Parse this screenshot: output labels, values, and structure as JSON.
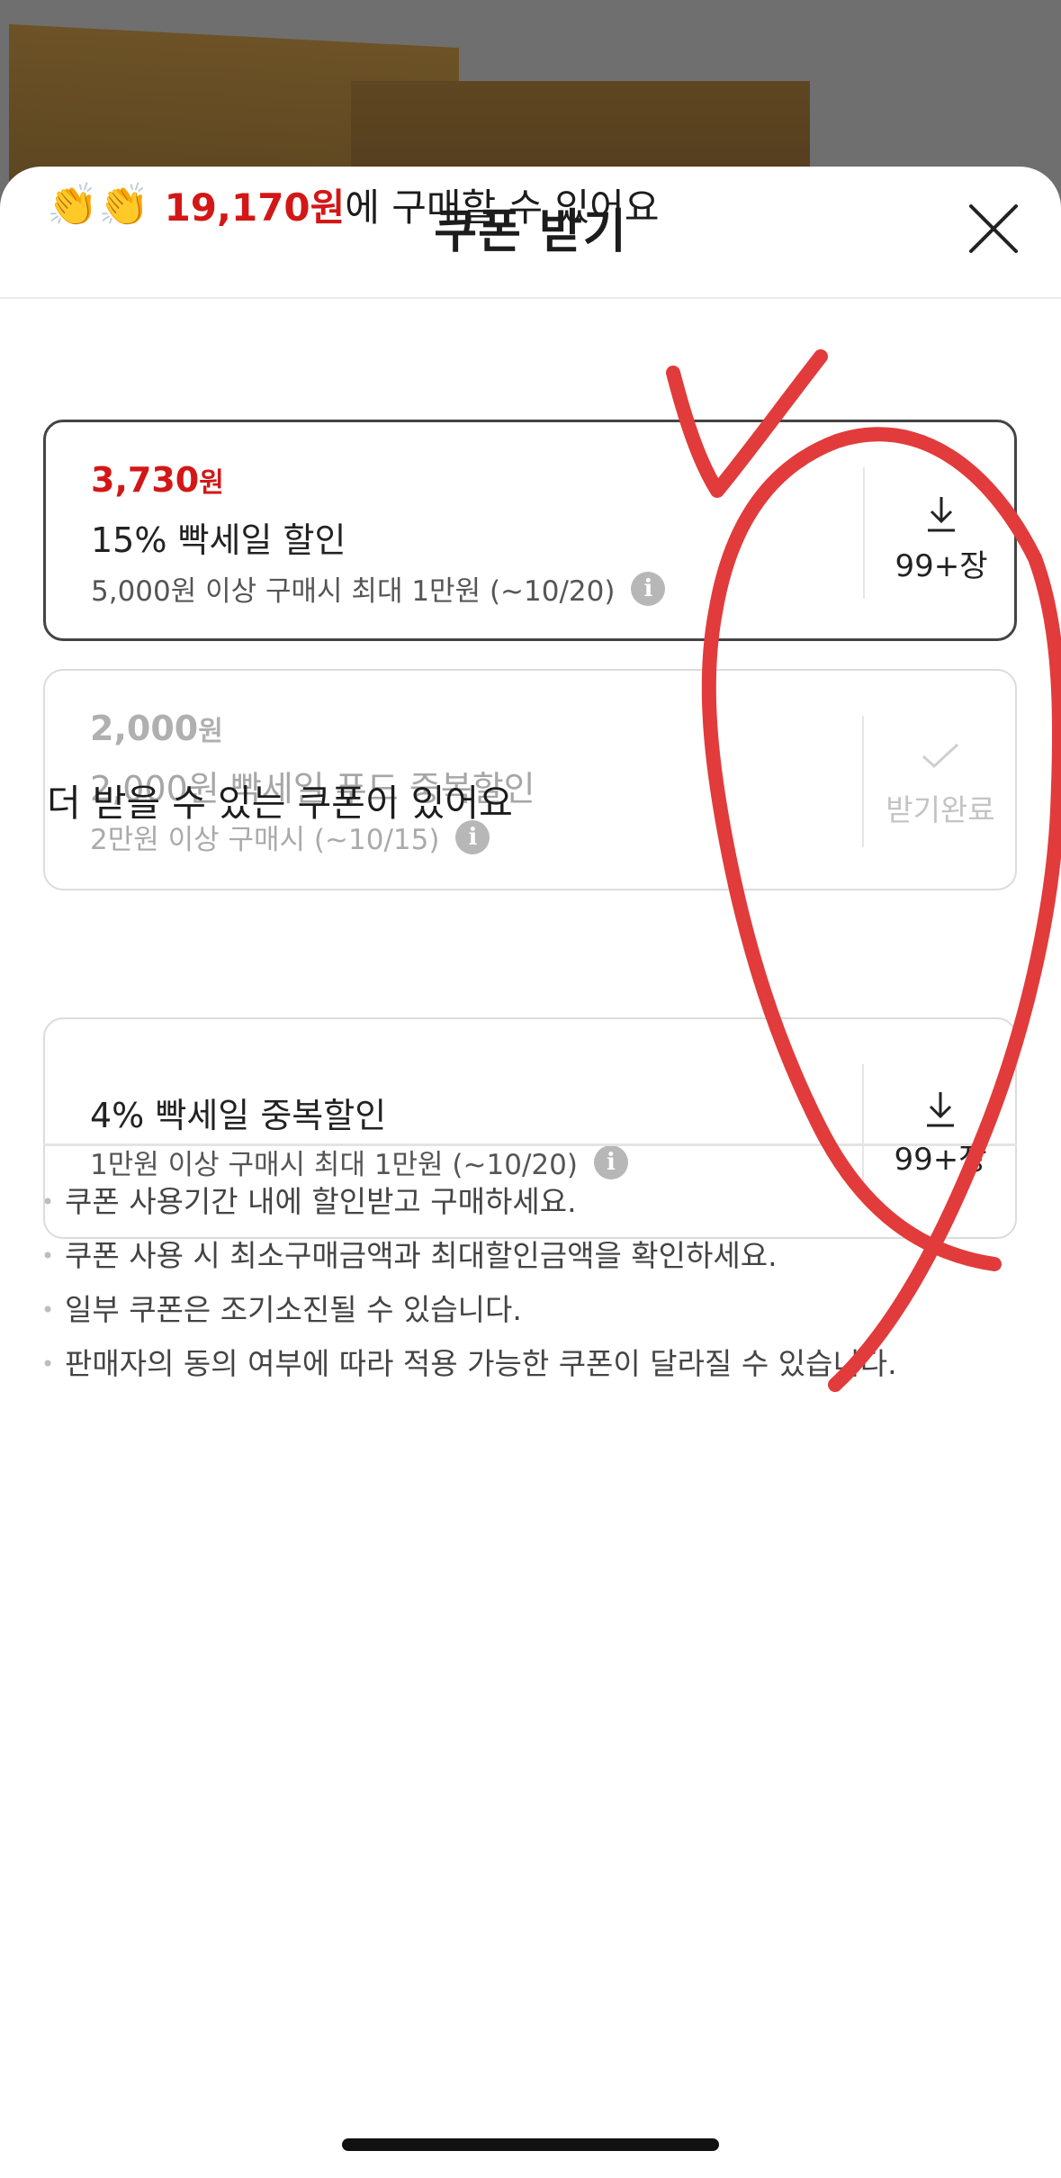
{
  "sheet": {
    "title": "쿠폰 받기",
    "close_label": "close"
  },
  "headline": {
    "emoji": "👏👏",
    "price": "19,170원",
    "suffix": "에 구매할 수 있어요"
  },
  "coupons": [
    {
      "amount": "3,730",
      "unit": "원",
      "name": "15% 빡세일 할인",
      "condition": "5,000원 이상 구매시 최대 1만원 (~10/20)",
      "action": "99+장",
      "state": "available"
    },
    {
      "amount": "2,000",
      "unit": "원",
      "name": "2,000원 빡세일 푸드 중복할인",
      "condition": "2만원 이상 구매시 (~10/15)",
      "action": "받기완료",
      "state": "received"
    }
  ],
  "more_section": {
    "title": "더 받을 수 있는 쿠폰이 있어요",
    "coupons": [
      {
        "name": "4% 빡세일 중복할인",
        "condition": "1만원 이상 구매시 최대 1만원 (~10/20)",
        "action": "99+장"
      }
    ]
  },
  "notes": [
    "쿠폰 사용기간 내에 할인받고 구매하세요.",
    "쿠폰 사용 시 최소구매금액과 최대할인금액을 확인하세요.",
    "일부 쿠폰은 조기소진될 수 있습니다.",
    "판매자의 동의 여부에 따라 적용 가능한 쿠폰이 달라질 수 있습니다."
  ],
  "icons": {
    "info": "i",
    "close": "close-icon",
    "download": "download-icon",
    "check": "check-icon"
  },
  "colors": {
    "accent_red": "#d31717",
    "annotation_red": "#e23b3b"
  }
}
